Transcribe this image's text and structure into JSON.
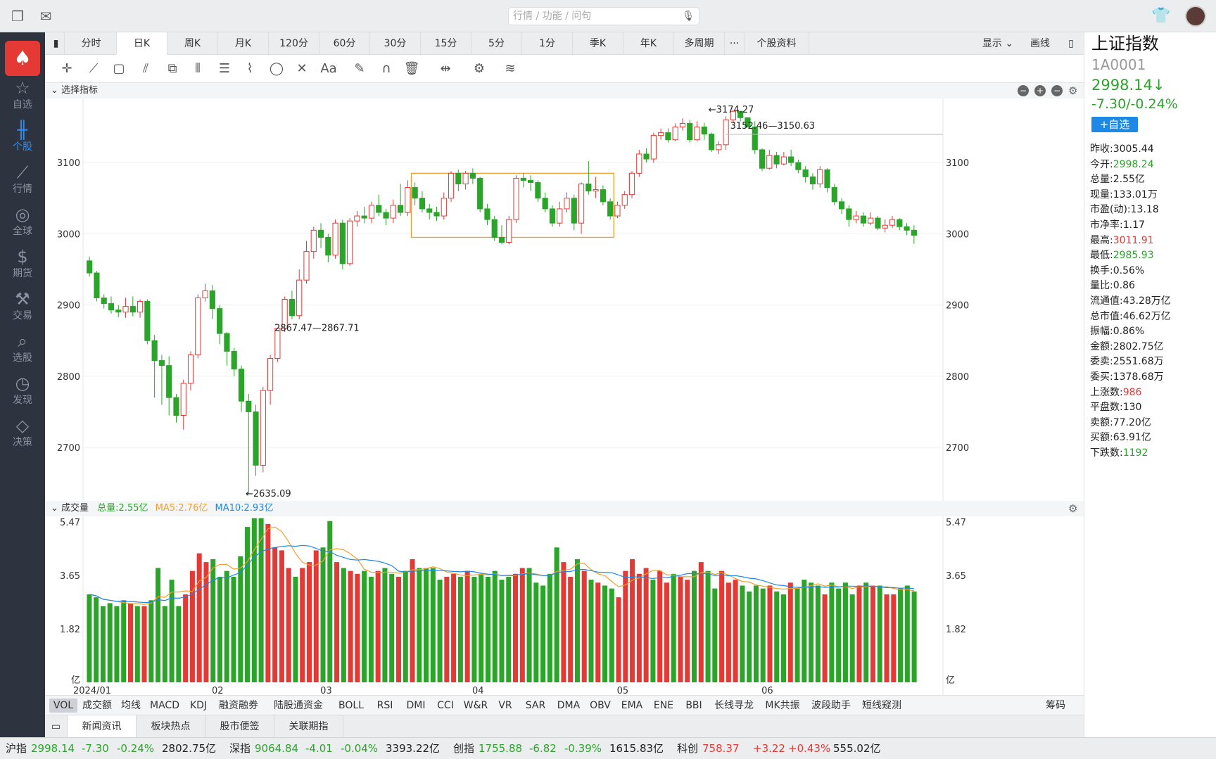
{
  "search": {
    "placeholder": "行情 / 功能 / 问句"
  },
  "sidebar": [
    {
      "icon": "star-icon",
      "label": "自选"
    },
    {
      "icon": "candlestick-icon",
      "label": "个股"
    },
    {
      "icon": "line-chart-icon",
      "label": "行情"
    },
    {
      "icon": "globe-icon",
      "label": "全球"
    },
    {
      "icon": "dollar-icon",
      "label": "期货"
    },
    {
      "icon": "gavel-icon",
      "label": "交易"
    },
    {
      "icon": "search-chart-icon",
      "label": "选股"
    },
    {
      "icon": "compass-icon",
      "label": "发现"
    },
    {
      "icon": "diamond-icon",
      "label": "决策"
    }
  ],
  "tabs": [
    "分时",
    "日K",
    "周K",
    "月K",
    "120分",
    "60分",
    "30分",
    "15分",
    "5分",
    "1分",
    "季K",
    "年K",
    "多周期",
    "···",
    "个股资料"
  ],
  "tabs_right": {
    "display": "显示",
    "draw": "画线"
  },
  "indicator_header": "选择指标",
  "stock": {
    "name": "上证指数",
    "code": "1A0001",
    "price": "2998.14↓",
    "change": "-7.30/-0.24%",
    "add_label": "+自选"
  },
  "stats": [
    {
      "label": "昨收:",
      "value": "3005.44",
      "color": "black"
    },
    {
      "label": "今开:",
      "value": "2998.24",
      "color": "green"
    },
    {
      "label": "总量:",
      "value": "2.55亿",
      "color": "black"
    },
    {
      "label": "现量:",
      "value": "133.01万",
      "color": "black"
    },
    {
      "label": "市盈(动):",
      "value": "13.18",
      "color": "black"
    },
    {
      "label": "市净率:",
      "value": "1.17",
      "color": "black"
    },
    {
      "label": "最高:",
      "value": "3011.91",
      "color": "red"
    },
    {
      "label": "最低:",
      "value": "2985.93",
      "color": "green"
    },
    {
      "label": "换手:",
      "value": "0.56%",
      "color": "black"
    },
    {
      "label": "量比:",
      "value": "0.86",
      "color": "black"
    },
    {
      "label": "流通值:",
      "value": "43.28万亿",
      "color": "black"
    },
    {
      "label": "总市值:",
      "value": "46.62万亿",
      "color": "black"
    },
    {
      "label": "振幅:",
      "value": "0.86%",
      "color": "black"
    },
    {
      "label": "金额:",
      "value": "2802.75亿",
      "color": "black"
    },
    {
      "label": "委卖:",
      "value": "2551.68万",
      "color": "black"
    },
    {
      "label": "委买:",
      "value": "1378.68万",
      "color": "black"
    },
    {
      "label": "上涨数:",
      "value": "986",
      "color": "red"
    },
    {
      "label": "平盘数:",
      "value": "130",
      "color": "black"
    },
    {
      "label": "卖额:",
      "value": "77.20亿",
      "color": "black"
    },
    {
      "label": "买额:",
      "value": "63.91亿",
      "color": "black"
    },
    {
      "label": "下跌数:",
      "value": "1192",
      "color": "green"
    }
  ],
  "chart_data": {
    "type": "candlestick",
    "y_ticks": [
      2700,
      2800,
      2900,
      3000,
      3100
    ],
    "ylim": [
      2625,
      3190
    ],
    "x_labels": [
      {
        "label": "2024/01",
        "index": 0
      },
      {
        "label": "02",
        "index": 18
      },
      {
        "label": "03",
        "index": 33
      },
      {
        "label": "04",
        "index": 54
      },
      {
        "label": "05",
        "index": 74
      },
      {
        "label": "06",
        "index": 94
      }
    ],
    "annotations": [
      {
        "text": "←2635.09",
        "index": 21,
        "value": 2635.09
      },
      {
        "text": "2867.47—2867.71",
        "index": 25,
        "value": 2867.6
      },
      {
        "text": "←3174.27",
        "index": 85,
        "value": 3174.27
      },
      {
        "text": "3152.46—3150.63",
        "index": 88,
        "value": 3151.5
      }
    ],
    "range_box": {
      "start_index": 45,
      "end_index": 72,
      "low": 2995,
      "high": 3085
    },
    "candles": [
      [
        2962,
        2945,
        2968,
        2940
      ],
      [
        2945,
        2910,
        2948,
        2905
      ],
      [
        2910,
        2902,
        2915,
        2895
      ],
      [
        2902,
        2893,
        2912,
        2888
      ],
      [
        2893,
        2890,
        2900,
        2883
      ],
      [
        2890,
        2898,
        2910,
        2882
      ],
      [
        2898,
        2890,
        2912,
        2884
      ],
      [
        2890,
        2905,
        2908,
        2882
      ],
      [
        2905,
        2850,
        2908,
        2845
      ],
      [
        2850,
        2822,
        2858,
        2770
      ],
      [
        2822,
        2815,
        2830,
        2760
      ],
      [
        2815,
        2770,
        2828,
        2745
      ],
      [
        2770,
        2745,
        2775,
        2735
      ],
      [
        2745,
        2790,
        2795,
        2725
      ],
      [
        2790,
        2830,
        2835,
        2780
      ],
      [
        2830,
        2910,
        2915,
        2825
      ],
      [
        2910,
        2920,
        2930,
        2905
      ],
      [
        2920,
        2895,
        2928,
        2880
      ],
      [
        2895,
        2860,
        2900,
        2845
      ],
      [
        2860,
        2835,
        2862,
        2815
      ],
      [
        2835,
        2810,
        2840,
        2800
      ],
      [
        2810,
        2765,
        2815,
        2750
      ],
      [
        2765,
        2750,
        2775,
        2635
      ],
      [
        2750,
        2675,
        2760,
        2660
      ],
      [
        2675,
        2780,
        2785,
        2665
      ],
      [
        2780,
        2825,
        2830,
        2760
      ],
      [
        2825,
        2867,
        2868,
        2820
      ],
      [
        2867,
        2908,
        2912,
        2862
      ],
      [
        2908,
        2885,
        2920,
        2880
      ],
      [
        2885,
        2935,
        2950,
        2880
      ],
      [
        2935,
        2975,
        2990,
        2930
      ],
      [
        2975,
        3005,
        3010,
        2965
      ],
      [
        3005,
        2995,
        3015,
        2980
      ],
      [
        2995,
        2970,
        3000,
        2960
      ],
      [
        2970,
        3015,
        3020,
        2965
      ],
      [
        3015,
        2958,
        3020,
        2950
      ],
      [
        2958,
        3018,
        3022,
        2955
      ],
      [
        3018,
        3025,
        3032,
        3010
      ],
      [
        3025,
        3022,
        3038,
        3015
      ],
      [
        3022,
        3040,
        3045,
        3015
      ],
      [
        3040,
        3030,
        3055,
        3025
      ],
      [
        3030,
        3022,
        3035,
        3012
      ],
      [
        3022,
        3040,
        3048,
        3015
      ],
      [
        3040,
        3030,
        3070,
        3025
      ],
      [
        3030,
        3065,
        3075,
        3025
      ],
      [
        3065,
        3050,
        3072,
        3040
      ],
      [
        3050,
        3035,
        3060,
        3030
      ],
      [
        3035,
        3030,
        3042,
        3020
      ],
      [
        3030,
        3025,
        3038,
        3018
      ],
      [
        3025,
        3050,
        3058,
        3020
      ],
      [
        3050,
        3085,
        3088,
        3045
      ],
      [
        3085,
        3070,
        3090,
        3060
      ],
      [
        3070,
        3085,
        3088,
        3062
      ],
      [
        3085,
        3078,
        3092,
        3070
      ],
      [
        3078,
        3035,
        3080,
        3030
      ],
      [
        3035,
        3020,
        3042,
        3012
      ],
      [
        3020,
        2995,
        3025,
        2990
      ],
      [
        2995,
        2988,
        3012,
        2985
      ],
      [
        2988,
        3020,
        3025,
        2985
      ],
      [
        3020,
        3078,
        3082,
        3015
      ],
      [
        3078,
        3075,
        3085,
        3065
      ],
      [
        3075,
        3072,
        3082,
        3060
      ],
      [
        3072,
        3050,
        3075,
        3045
      ],
      [
        3050,
        3035,
        3058,
        3030
      ],
      [
        3035,
        3015,
        3040,
        3010
      ],
      [
        3015,
        3035,
        3045,
        3010
      ],
      [
        3035,
        3050,
        3058,
        3030
      ],
      [
        3050,
        3015,
        3055,
        3005
      ],
      [
        3015,
        3070,
        3072,
        3000
      ],
      [
        3070,
        3060,
        3102,
        3055
      ],
      [
        3060,
        3062,
        3080,
        3050
      ],
      [
        3062,
        3045,
        3068,
        3040
      ],
      [
        3045,
        3025,
        3050,
        3020
      ],
      [
        3025,
        3040,
        3045,
        3022
      ],
      [
        3040,
        3055,
        3060,
        3035
      ],
      [
        3055,
        3085,
        3088,
        3050
      ],
      [
        3085,
        3112,
        3118,
        3080
      ],
      [
        3112,
        3105,
        3120,
        3100
      ],
      [
        3105,
        3138,
        3142,
        3100
      ],
      [
        3138,
        3142,
        3148,
        3132
      ],
      [
        3142,
        3132,
        3148,
        3128
      ],
      [
        3132,
        3150,
        3155,
        3130
      ],
      [
        3150,
        3155,
        3162,
        3145
      ],
      [
        3155,
        3132,
        3160,
        3128
      ],
      [
        3132,
        3150,
        3158,
        3130
      ],
      [
        3150,
        3140,
        3156,
        3132
      ],
      [
        3140,
        3118,
        3142,
        3115
      ],
      [
        3118,
        3125,
        3130,
        3112
      ],
      [
        3125,
        3160,
        3165,
        3118
      ],
      [
        3160,
        3172,
        3174.27,
        3155
      ],
      [
        3172,
        3163,
        3170,
        3158
      ],
      [
        3163,
        3150,
        3163,
        3150
      ],
      [
        3150,
        3118,
        3158,
        3112
      ],
      [
        3118,
        3092,
        3120,
        3088
      ],
      [
        3092,
        3110,
        3118,
        3090
      ],
      [
        3110,
        3098,
        3115,
        3092
      ],
      [
        3098,
        3108,
        3115,
        3096
      ],
      [
        3108,
        3100,
        3118,
        3095
      ],
      [
        3100,
        3090,
        3104,
        3085
      ],
      [
        3090,
        3080,
        3095,
        3072
      ],
      [
        3080,
        3070,
        3085,
        3062
      ],
      [
        3070,
        3090,
        3095,
        3065
      ],
      [
        3090,
        3065,
        3092,
        3058
      ],
      [
        3065,
        3045,
        3070,
        3040
      ],
      [
        3045,
        3035,
        3050,
        3028
      ],
      [
        3035,
        3020,
        3040,
        3010
      ],
      [
        3020,
        3025,
        3032,
        3015
      ],
      [
        3025,
        3015,
        3030,
        3010
      ],
      [
        3015,
        3022,
        3030,
        3012
      ],
      [
        3022,
        3008,
        3025,
        3005
      ],
      [
        3008,
        3012,
        3020,
        3002
      ],
      [
        3012,
        3020,
        3025,
        3008
      ],
      [
        3020,
        3010,
        3022,
        3005
      ],
      [
        3010,
        3005,
        3015,
        2998
      ],
      [
        3005,
        2998,
        3012,
        2986
      ]
    ],
    "volume": {
      "y_ticks": [
        "5.47",
        "3.65",
        "1.82",
        "亿"
      ],
      "ymax": 5.47,
      "legend": {
        "total": "总量:2.55亿",
        "ma5": "MA5:2.76亿",
        "ma10": "MA10:2.93亿"
      },
      "values": [
        3.0,
        2.9,
        2.6,
        2.7,
        2.6,
        2.8,
        2.7,
        2.6,
        2.6,
        2.8,
        3.9,
        2.6,
        3.5,
        2.6,
        3.0,
        3.8,
        4.4,
        4.1,
        4.2,
        3.6,
        3.8,
        3.6,
        4.3,
        5.3,
        5.6,
        5.6,
        5.4,
        4.6,
        4.5,
        3.9,
        3.6,
        3.9,
        4.1,
        4.5,
        4.6,
        5.5,
        4.1,
        3.9,
        3.8,
        3.7,
        3.8,
        3.6,
        3.8,
        3.9,
        3.7,
        3.6,
        3.8,
        4.2,
        3.9,
        3.9,
        3.9,
        3.5,
        3.6,
        3.7,
        3.6,
        3.8,
        3.6,
        3.7,
        3.6,
        3.8,
        3.5,
        3.6,
        3.7,
        3.9,
        3.9,
        3.4,
        3.3,
        3.7,
        4.6,
        4.1,
        3.6,
        4.2,
        3.8,
        3.5,
        3.4,
        3.3,
        3.2,
        2.9,
        3.8,
        4.2,
        3.7,
        3.9,
        3.5,
        3.8,
        3.4,
        3.7,
        3.6,
        3.5,
        3.8,
        4.1,
        3.8,
        3.2,
        3.8,
        3.4,
        3.5,
        3.3,
        3.1,
        3.3,
        3.2,
        3.3,
        3.1,
        3.0,
        3.4,
        3.2,
        3.5,
        3.4,
        3.3,
        3.0,
        3.4,
        3.2,
        3.4,
        3.0,
        3.3,
        3.4,
        3.3,
        3.3,
        3.0,
        3.0,
        3.2,
        3.3,
        3.1
      ]
    }
  },
  "indicators": [
    "VOL",
    "成交额",
    "均线",
    "MACD",
    "KDJ",
    "融资融券",
    "陆股通资金",
    "BOLL",
    "RSI",
    "DMI",
    "CCI",
    "W&R",
    "VR",
    "SAR",
    "DMA",
    "OBV",
    "EMA",
    "ENE",
    "BBI",
    "长线寻龙",
    "MK共振",
    "波段助手",
    "短线窥测"
  ],
  "indicators_right": "筹码",
  "news_tabs": [
    "新闻资讯",
    "板块热点",
    "股市便签",
    "关联期指"
  ],
  "status": [
    {
      "name": "沪指",
      "price": "2998.14",
      "chg": "-7.30",
      "pct": "-0.24%",
      "amt": "2802.75亿",
      "color": "green"
    },
    {
      "name": "深指",
      "price": "9064.84",
      "chg": "-4.01",
      "pct": "-0.04%",
      "amt": "3393.22亿",
      "color": "green"
    },
    {
      "name": "创指",
      "price": "1755.88",
      "chg": "-6.82",
      "pct": "-0.39%",
      "amt": "1615.83亿",
      "color": "green"
    },
    {
      "name": "科创",
      "price": "758.37",
      "chg": "+3.22",
      "pct": "+0.43%",
      "amt": "555.02亿",
      "color": "red"
    }
  ],
  "colors": {
    "up": "#e53935",
    "down": "#2aa52a",
    "ma5": "#f0a030",
    "ma10": "#1e88e5",
    "box": "#f0a030",
    "accent": "#2e8cf0"
  }
}
